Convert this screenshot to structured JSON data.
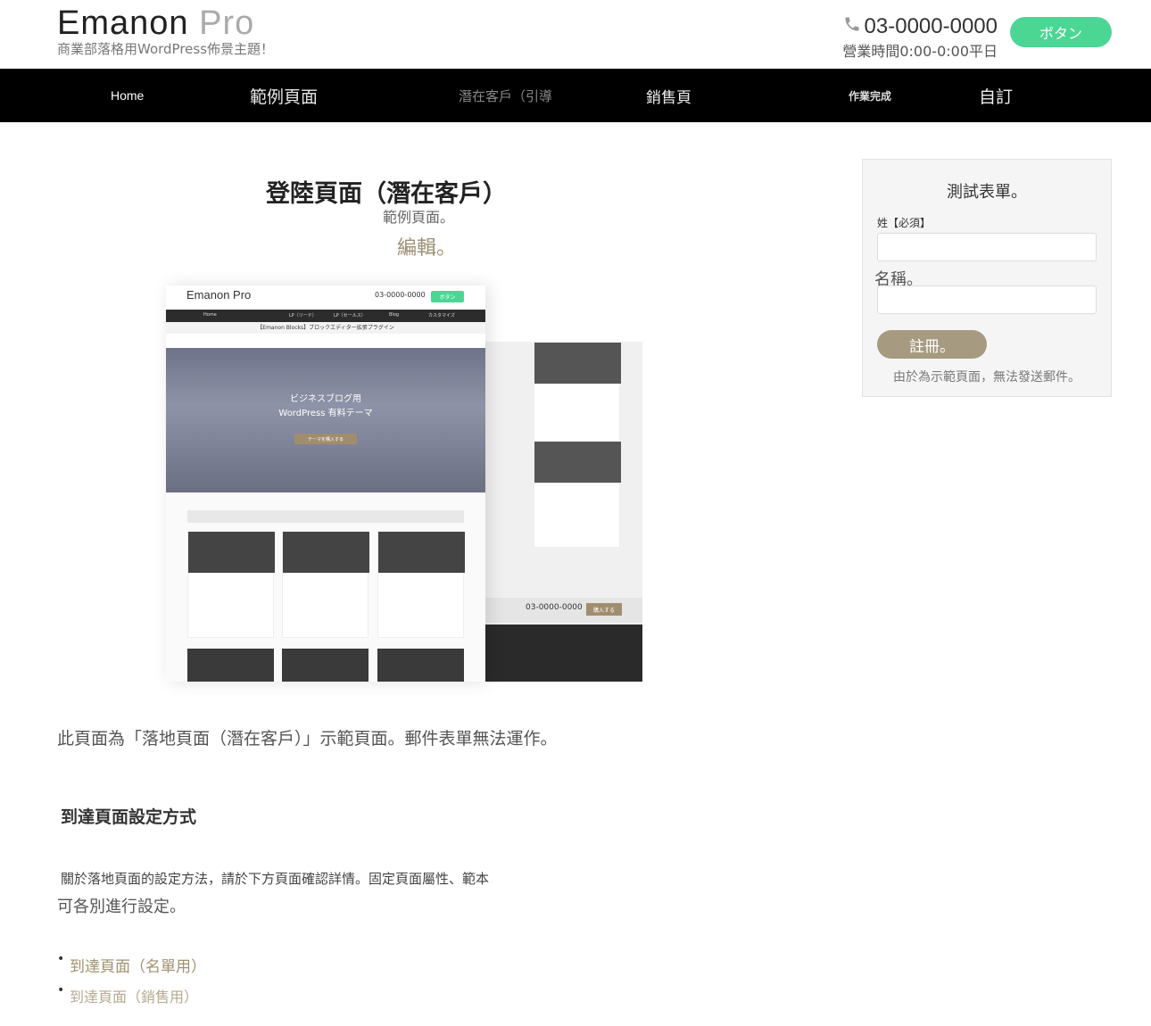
{
  "header": {
    "logo_main": "Emanon",
    "logo_light": "Pro",
    "tagline": "商業部落格用WordPress佈景主題！",
    "phone": "03-0000-0000",
    "hours": "營業時間0:00-0:00平日",
    "button_label": "ボタン"
  },
  "nav": {
    "items": [
      {
        "label": "Home"
      },
      {
        "label": "範例頁面"
      },
      {
        "label": "潛在客戶（引導"
      },
      {
        "label": "銷售頁"
      },
      {
        "label": "作業完成"
      },
      {
        "label": "自訂"
      }
    ]
  },
  "main": {
    "title": "登陸頁面（潛在客戶）",
    "subtitle": "範例頁面。",
    "edit_link": "編輯。",
    "mock": {
      "logo": "Emanon Pro",
      "phone": "03-0000-0000",
      "button": "ボタン",
      "nav": [
        "Home",
        "LP（リード）",
        "LP（セールス）",
        "Blog",
        "カスタマイズ"
      ],
      "bar": "【Emanon Blocks】ブロックエディター拡張プラグイン",
      "hero_line1": "ビジネスブログ用",
      "hero_line2": "WordPress 有料テーマ",
      "hero_button": "テーマを購入する",
      "footer_phone": "03-0000-0000",
      "footer_button": "購入する"
    },
    "intro": "此頁面為「落地頁面（潛在客戶）」示範頁面。郵件表單無法運作。",
    "section_heading": "到達頁面設定方式",
    "para1": "關於落地頁面的設定方法，請於下方頁面確認詳情。固定頁面屬性、範本",
    "para2": "可各別進行設定。",
    "links": [
      {
        "label": "到達頁面（名單用）"
      },
      {
        "label": "到達頁面（銷售用）"
      }
    ]
  },
  "sidebar": {
    "title": "測試表單。",
    "label_name": "姓【必須】",
    "label_title": "名稱。",
    "submit_label": "註冊。",
    "note": "由於為示範頁面，無法發送郵件。"
  }
}
